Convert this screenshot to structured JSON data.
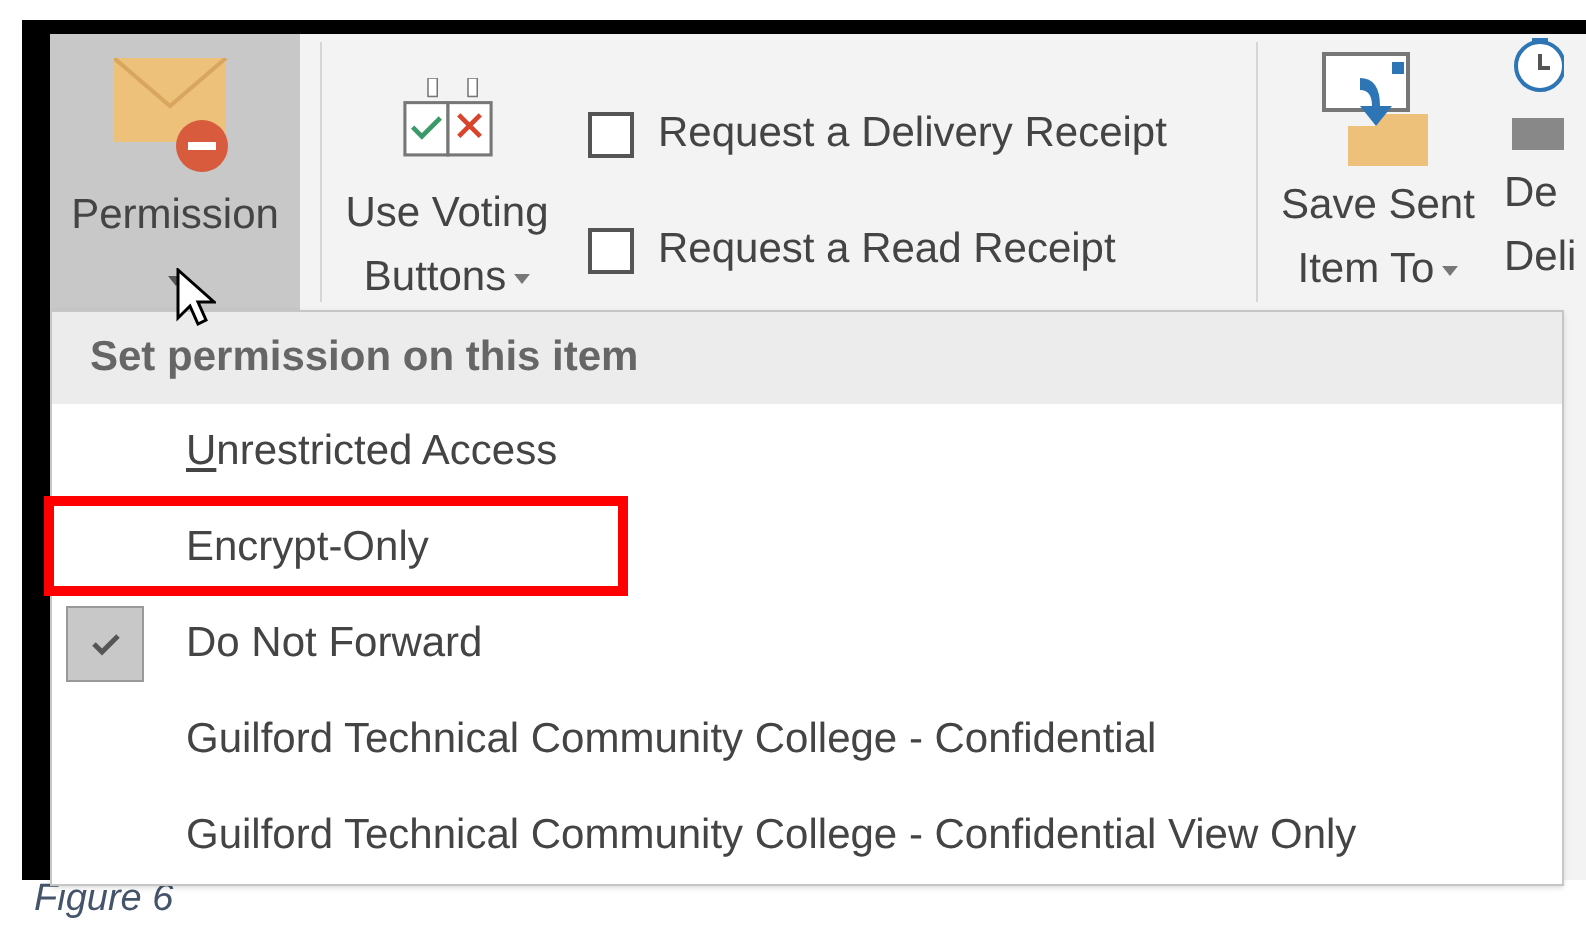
{
  "ribbon": {
    "permission": {
      "label": "Permission",
      "selected": true
    },
    "voting": {
      "label_line_1": "Use Voting",
      "label_line_2": "Buttons"
    },
    "checkboxes": [
      {
        "label": "Request a Delivery Receipt",
        "checked": false
      },
      {
        "label": "Request a Read Receipt",
        "checked": false
      }
    ],
    "save_sent": {
      "label_line_1": "Save Sent",
      "label_line_2": "Item To"
    },
    "delay": {
      "label_line_1": "De",
      "label_line_2": "Deli"
    }
  },
  "menu": {
    "header": "Set permission on this item",
    "items": [
      {
        "label": "Unrestricted Access",
        "checked": false,
        "highlighted": false,
        "underline_first": true
      },
      {
        "label": "Encrypt-Only",
        "checked": false,
        "highlighted": true,
        "underline_first": false
      },
      {
        "label": "Do Not Forward",
        "checked": true,
        "highlighted": false,
        "underline_first": false
      },
      {
        "label": "Guilford Technical Community College - Confidential",
        "checked": false,
        "highlighted": false,
        "underline_first": false
      },
      {
        "label": "Guilford Technical Community College - Confidential View Only",
        "checked": false,
        "highlighted": false,
        "underline_first": false
      }
    ]
  },
  "caption": "Figure 6"
}
